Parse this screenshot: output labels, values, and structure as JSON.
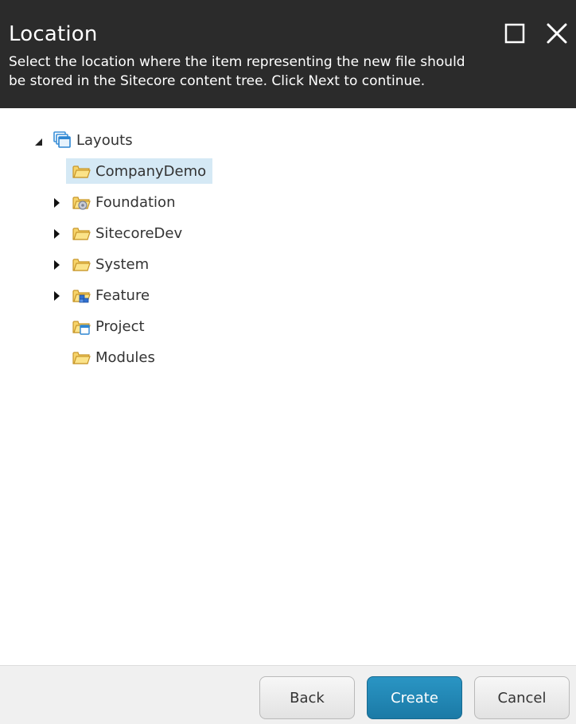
{
  "dialog": {
    "title": "Location",
    "description": "Select the location where the item representing the new file should be stored in the Sitecore content tree. Click Next to continue.",
    "maximize_icon": "maximize-icon",
    "close_icon": "close-icon"
  },
  "tree": {
    "root": {
      "label": "Layouts",
      "icon": "layouts-icon",
      "expanded": true
    },
    "children": [
      {
        "label": "CompanyDemo",
        "icon": "folder-icon",
        "selected": true,
        "has_children": false
      },
      {
        "label": "Foundation",
        "icon": "folder-gear-icon",
        "selected": false,
        "has_children": true
      },
      {
        "label": "SitecoreDev",
        "icon": "folder-icon",
        "selected": false,
        "has_children": true
      },
      {
        "label": "System",
        "icon": "folder-icon",
        "selected": false,
        "has_children": true
      },
      {
        "label": "Feature",
        "icon": "folder-feature-icon",
        "selected": false,
        "has_children": true
      },
      {
        "label": "Project",
        "icon": "folder-project-icon",
        "selected": false,
        "has_children": false
      },
      {
        "label": "Modules",
        "icon": "folder-icon",
        "selected": false,
        "has_children": false
      }
    ]
  },
  "footer": {
    "back_label": "Back",
    "create_label": "Create",
    "cancel_label": "Cancel"
  },
  "colors": {
    "header_bg": "#2b2b2b",
    "selection_bg": "#d5e9f5",
    "primary_button": "#1e86b5",
    "folder": "#f5c53a"
  }
}
